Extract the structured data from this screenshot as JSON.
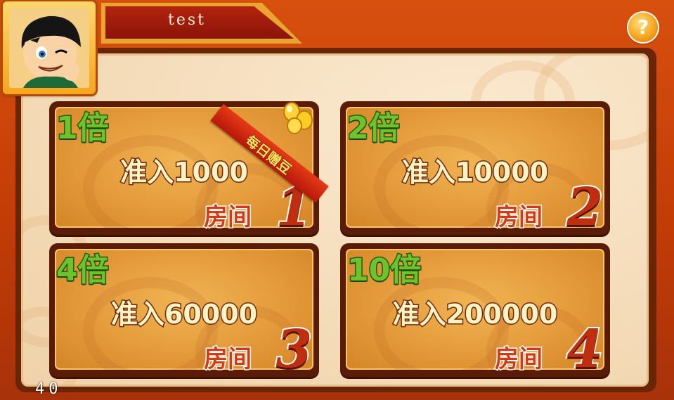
{
  "player": {
    "name": "test"
  },
  "help": {
    "label": "?"
  },
  "rooms": [
    {
      "multiplier": "1倍",
      "entry": "准入1000",
      "room_label": "房间",
      "room_number": "1",
      "ribbon": "每日赠豆"
    },
    {
      "multiplier": "2倍",
      "entry": "准入10000",
      "room_label": "房间",
      "room_number": "2"
    },
    {
      "multiplier": "4倍",
      "entry": "准入60000",
      "room_label": "房间",
      "room_number": "3"
    },
    {
      "multiplier": "10倍",
      "entry": "准入200000",
      "room_label": "房间",
      "room_number": "4"
    }
  ],
  "fps": "40",
  "colors": {
    "background": "#c8430a",
    "panel": "#f4dbb8",
    "card": "#e49a3a",
    "multiplier_green": "#6fc22a",
    "room_red": "#c02e10",
    "ribbon_red": "#d62a12"
  }
}
